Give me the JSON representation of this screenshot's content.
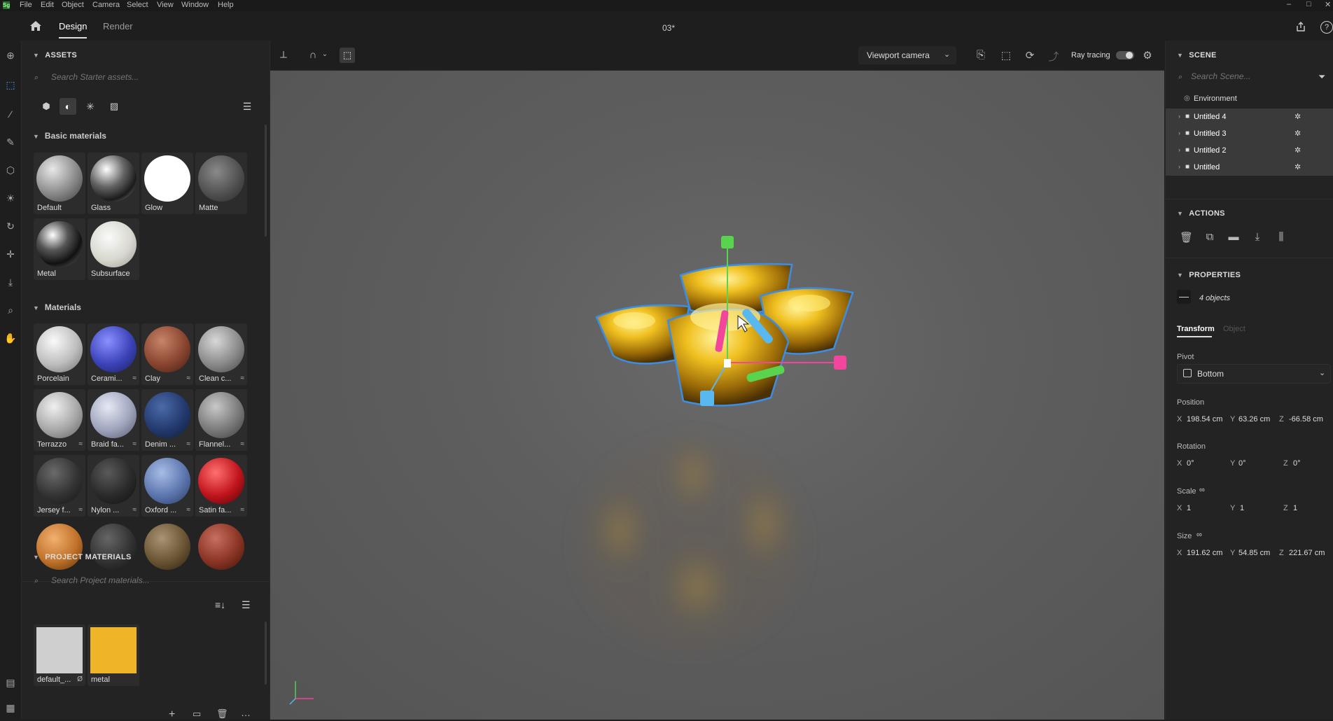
{
  "menubar": {
    "logo": "Sg",
    "items": [
      "File",
      "Edit",
      "Object",
      "Camera",
      "Select",
      "View",
      "Window",
      "Help"
    ],
    "window_controls": [
      "–",
      "□",
      "✕"
    ]
  },
  "header": {
    "tabs": [
      "Design",
      "Render"
    ],
    "doc_title": "03*"
  },
  "assets": {
    "title": "ASSETS",
    "search_placeholder": "Search Starter assets...",
    "basic_title": "Basic materials",
    "basic": [
      {
        "label": "Default"
      },
      {
        "label": "Glass"
      },
      {
        "label": "Glow"
      },
      {
        "label": "Matte"
      },
      {
        "label": "Metal"
      },
      {
        "label": "Subsurface"
      }
    ],
    "materials_title": "Materials",
    "materials": [
      {
        "label": "Porcelain",
        "opt": ""
      },
      {
        "label": "Cerami...",
        "opt": "≈"
      },
      {
        "label": "Clay",
        "opt": "≈"
      },
      {
        "label": "Clean c...",
        "opt": "≈"
      },
      {
        "label": "Terrazzo",
        "opt": "≈"
      },
      {
        "label": "Braid fa...",
        "opt": "≈"
      },
      {
        "label": "Denim ...",
        "opt": "≈"
      },
      {
        "label": "Flannel...",
        "opt": "≈"
      },
      {
        "label": "Jersey f...",
        "opt": "≈"
      },
      {
        "label": "Nylon ...",
        "opt": "≈"
      },
      {
        "label": "Oxford ...",
        "opt": "≈"
      },
      {
        "label": "Satin fa...",
        "opt": "≈"
      }
    ],
    "project_title": "PROJECT MATERIALS",
    "project_search_placeholder": "Search Project materials...",
    "project": [
      {
        "label": "default_...",
        "opt": "Ø"
      },
      {
        "label": "metal",
        "opt": ""
      }
    ]
  },
  "viewport": {
    "camera": "Viewport camera",
    "ray_tracing_label": "Ray tracing"
  },
  "scene": {
    "title": "SCENE",
    "search_placeholder": "Search Scene...",
    "environment": "Environment",
    "items": [
      "Untitled 4",
      "Untitled 3",
      "Untitled 2",
      "Untitled"
    ]
  },
  "actions": {
    "title": "ACTIONS"
  },
  "properties": {
    "title": "PROPERTIES",
    "selection": "4 objects",
    "tabs": [
      "Transform",
      "Object"
    ],
    "pivot_label": "Pivot",
    "pivot_value": "Bottom",
    "position_label": "Position",
    "position": {
      "x": "198.54 cm",
      "y": "63.26 cm",
      "z": "-66.58 cm"
    },
    "rotation_label": "Rotation",
    "rotation": {
      "x": "0°",
      "y": "0°",
      "z": "0°"
    },
    "scale_label": "Scale",
    "scale": {
      "x": "1",
      "y": "1",
      "z": "1"
    },
    "size_label": "Size",
    "size": {
      "x": "191.62 cm",
      "y": "54.85 cm",
      "z": "221.67 cm"
    }
  },
  "colors": {
    "accent_blue": "#3a8ee6",
    "gold": "#f0b429",
    "gizmo_green": "#58d44e",
    "gizmo_pink": "#f2459b",
    "gizmo_blue": "#5ab8f0"
  }
}
